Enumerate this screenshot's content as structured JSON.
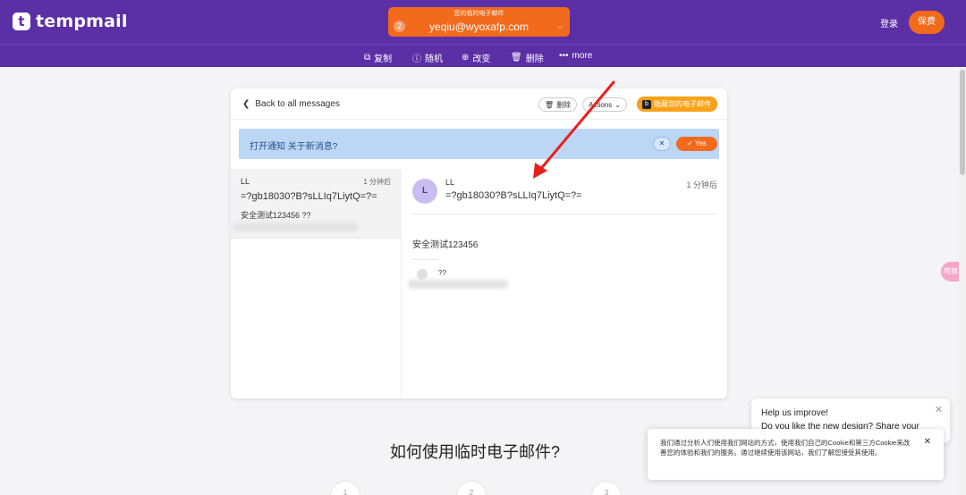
{
  "header": {
    "logo_letter": "t",
    "logo_text": "tempmail",
    "email_caption": "您的临时电子邮件",
    "email_count": "2",
    "email_address": "yeqiu@wyoxafp.com",
    "login": "登录",
    "premium": "保费"
  },
  "actions": {
    "copy": "复制",
    "random": "随机",
    "change": "改变",
    "delete": "删除",
    "more": "more"
  },
  "card": {
    "back": "Back to all messages",
    "delete": "删除",
    "actions": "Actions",
    "hide_email": "隐藏您的电子邮件",
    "hide_badge": "b"
  },
  "notify": {
    "text": "打开通知 关于新消息?",
    "yes": "Yes"
  },
  "list": {
    "from": "LL",
    "time": "1 分钟后",
    "subject": "=?gb18030?B?sLLIq7LiytQ=?=",
    "preview": "安全测试123456 ??"
  },
  "detail": {
    "avatar_letter": "L",
    "from": "LL",
    "subject": "=?gb18030?B?sLLIq7LiytQ=?=",
    "time": "1 分钟后",
    "body": "安全测试123456",
    "signature": "??"
  },
  "how": {
    "title": "如何使用临时电子邮件?",
    "steps": [
      "1",
      "2",
      "3"
    ]
  },
  "help": {
    "title": "Help us improve!",
    "subtitle": "Do you like the new design? Share your"
  },
  "cookie": {
    "text": "我们通过分析人们使用我们网站的方式，使用我们自己的Cookie和第三方Cookie来改善您的体验和我们的服务。通过继续使用该网站，我们了解您接受其使用。"
  },
  "side_fab": "转换",
  "colors": {
    "brand_purple": "#5b2fa6",
    "accent_orange": "#f26a1b",
    "notify_blue": "#bcd6f6",
    "arrow_red": "#e8201c"
  }
}
